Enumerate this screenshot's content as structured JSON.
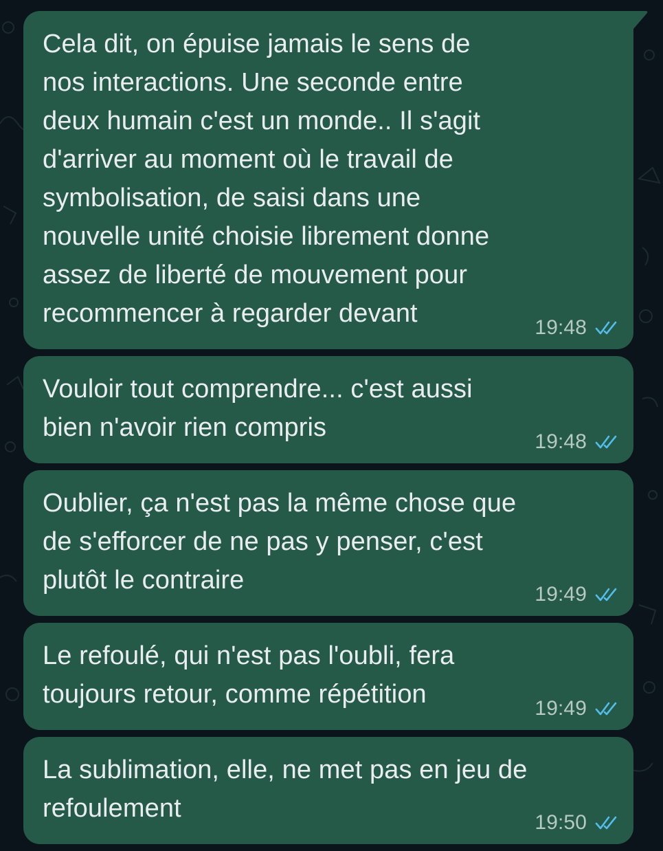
{
  "colors": {
    "background": "#0b141a",
    "bubble_outgoing": "#255948",
    "text": "#e9edef",
    "timestamp": "#b6c9c2",
    "read_ticks": "#53bdeb"
  },
  "messages": [
    {
      "text": "Cela dit, on épuise jamais le sens de\nnos interactions. Une seconde entre\ndeux humain c'est un monde.. Il s'agit\nd'arriver au moment où le travail de\nsymbolisation, de saisi dans une\nnouvelle unité choisie librement donne\nassez de liberté de mouvement pour\nrecommencer à regarder devant",
      "time": "19:48",
      "status_icon": "double-check-read-icon"
    },
    {
      "text": "Vouloir tout comprendre... c'est aussi\nbien n'avoir rien compris",
      "time": "19:48",
      "status_icon": "double-check-read-icon"
    },
    {
      "text": "Oublier, ça n'est pas la même chose que\nde s'efforcer de ne pas y penser, c'est\nplutôt le contraire",
      "time": "19:49",
      "status_icon": "double-check-read-icon"
    },
    {
      "text": "Le refoulé, qui n'est pas l'oubli, fera\ntoujours retour, comme répétition",
      "time": "19:49",
      "status_icon": "double-check-read-icon"
    },
    {
      "text": "La sublimation, elle, ne met pas en jeu de\nrefoulement",
      "time": "19:50",
      "status_icon": "double-check-read-icon"
    }
  ]
}
